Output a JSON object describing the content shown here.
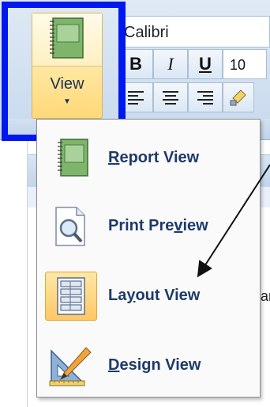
{
  "ribbon": {
    "view_button_label": "View",
    "font_name": "Calibri",
    "bold_glyph": "B",
    "italic_glyph": "I",
    "underline_glyph": "U",
    "font_size": "10"
  },
  "menu": {
    "items": [
      {
        "label_pre": "",
        "label_accel": "R",
        "label_post": "eport View",
        "icon": "report-view-icon",
        "active": false
      },
      {
        "label_pre": "Print Pre",
        "label_accel": "v",
        "label_post": "iew",
        "icon": "print-preview-icon",
        "active": false
      },
      {
        "label_pre": "La",
        "label_accel": "y",
        "label_post": "out View",
        "icon": "layout-view-icon",
        "active": true
      },
      {
        "label_pre": "",
        "label_accel": "D",
        "label_post": "esign View",
        "icon": "design-view-icon",
        "active": false
      }
    ]
  },
  "background": {
    "peek_text": "an"
  },
  "colors": {
    "highlight_box": "#0018f0",
    "active_item": "#ffc766",
    "menu_text": "#1e3a6b"
  }
}
